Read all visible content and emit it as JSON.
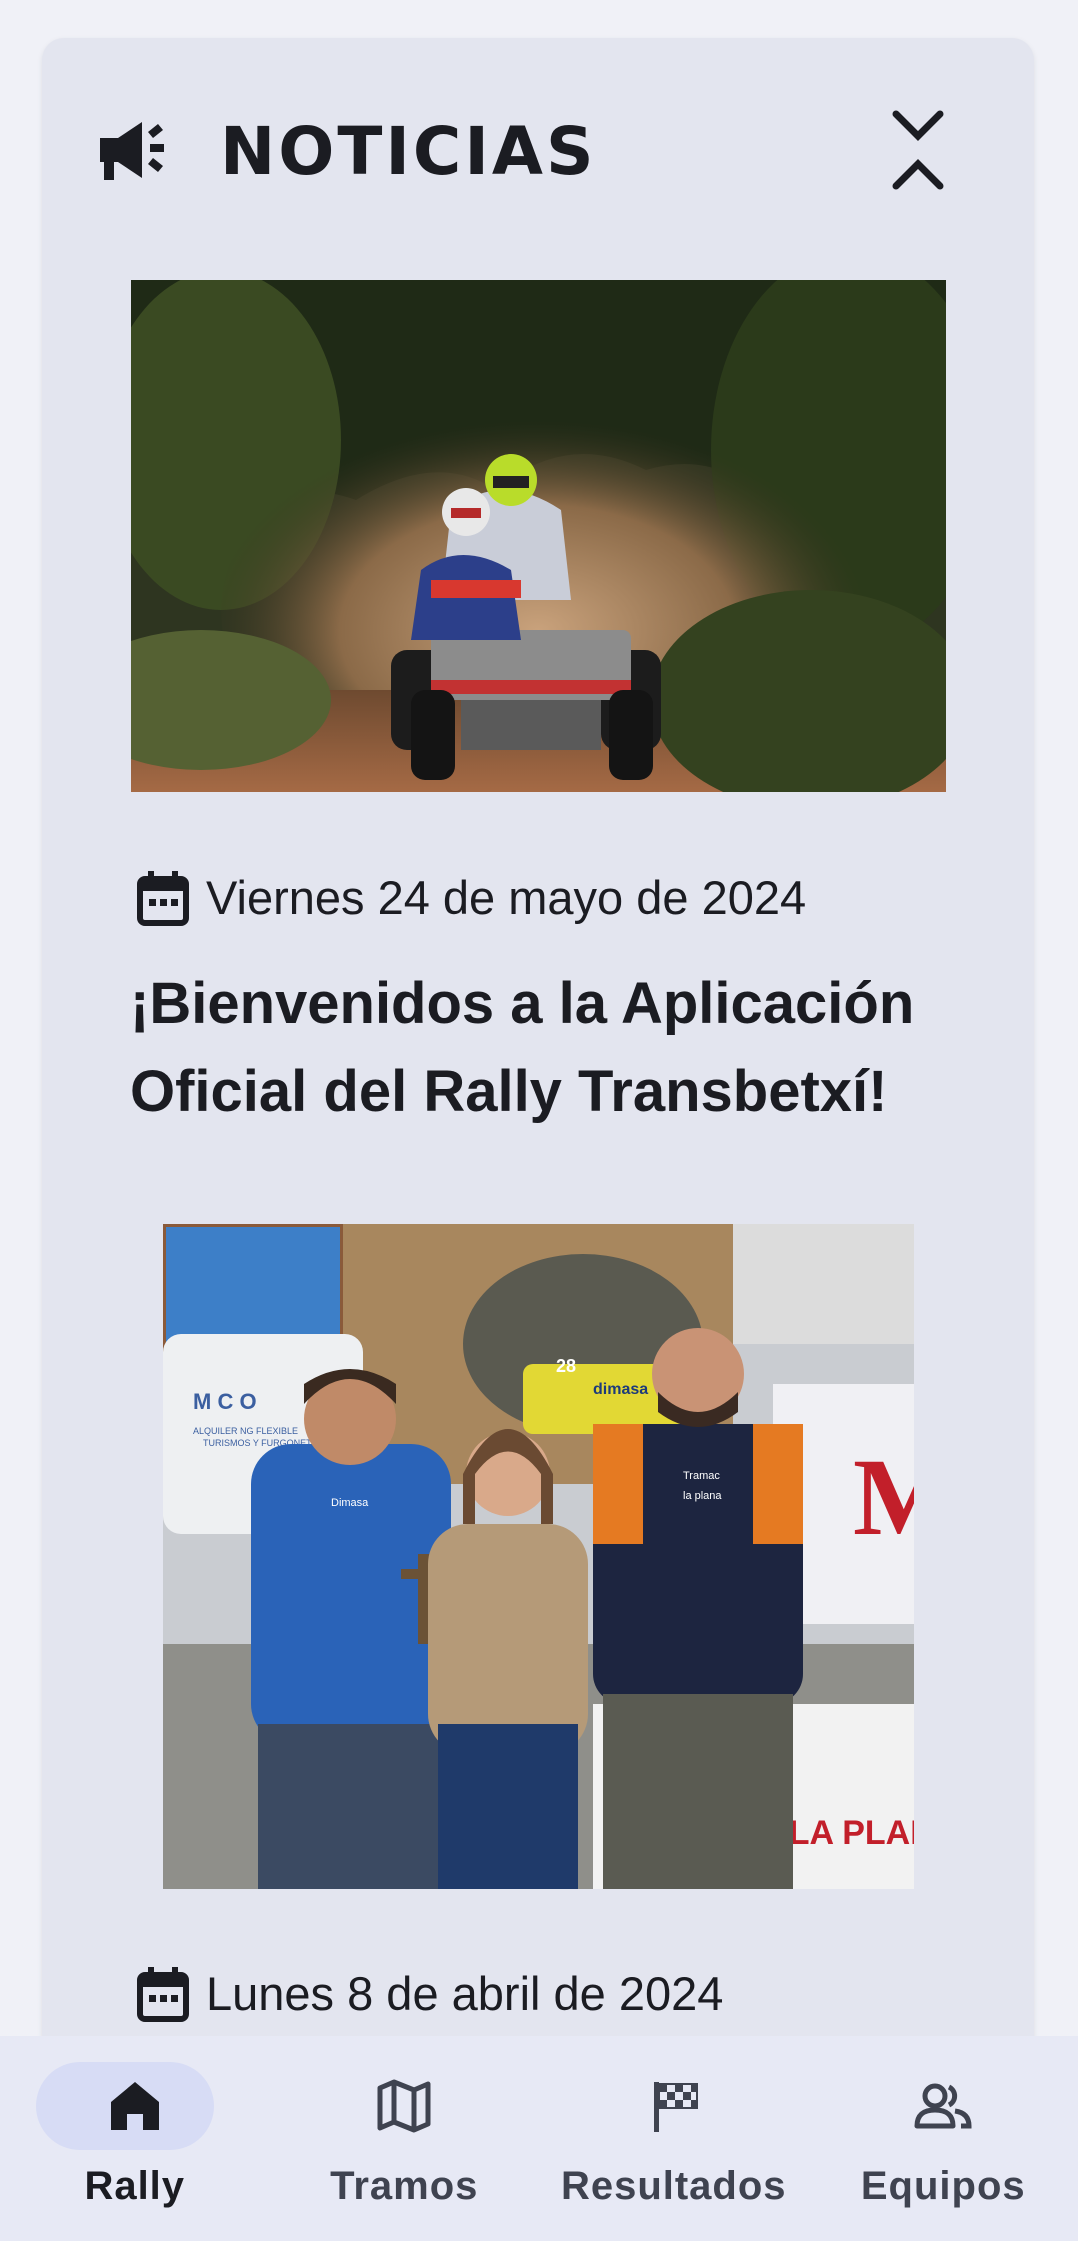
{
  "news_section": {
    "title": "NOTICIAS",
    "header_icon": "campaign-icon",
    "collapse_icon": "collapse-chevrons-icon"
  },
  "news": [
    {
      "date": "Viernes 24 de mayo de 2024",
      "title": "¡Bienvenidos a la Aplicación Oficial del Rally Transbetxí!",
      "image": "quad-rally-photo"
    },
    {
      "date": "Lunes 8 de abril de 2024",
      "image": "trophy-group-photo",
      "photo_text": {
        "van_logo": "M   C O",
        "van_line1": "ALQUILER     NG FLEXIBLE",
        "van_line2": "TURISMOS Y FURGONETAS",
        "quad_number": "28",
        "quad_sponsor": "dimasa",
        "banner": "M",
        "jacket_logo": "Dimasa",
        "shirt_logo": "Tramac",
        "shirt_logo2": "la plana",
        "barrier_text": "RALLY DE LA PLANA"
      }
    }
  ],
  "bottom_nav": {
    "items": [
      {
        "label": "Rally",
        "icon": "home-icon",
        "active": true
      },
      {
        "label": "Tramos",
        "icon": "map-icon",
        "active": false
      },
      {
        "label": "Resultados",
        "icon": "checkered-flag-icon",
        "active": false
      },
      {
        "label": "Equipos",
        "icon": "people-icon",
        "active": false
      }
    ]
  },
  "colors": {
    "background": "#f0f1f7",
    "card": "#e3e5ef",
    "nav_background": "#e7e9f5",
    "nav_active_pill": "#d7dcf5",
    "text": "#1b1c22"
  }
}
